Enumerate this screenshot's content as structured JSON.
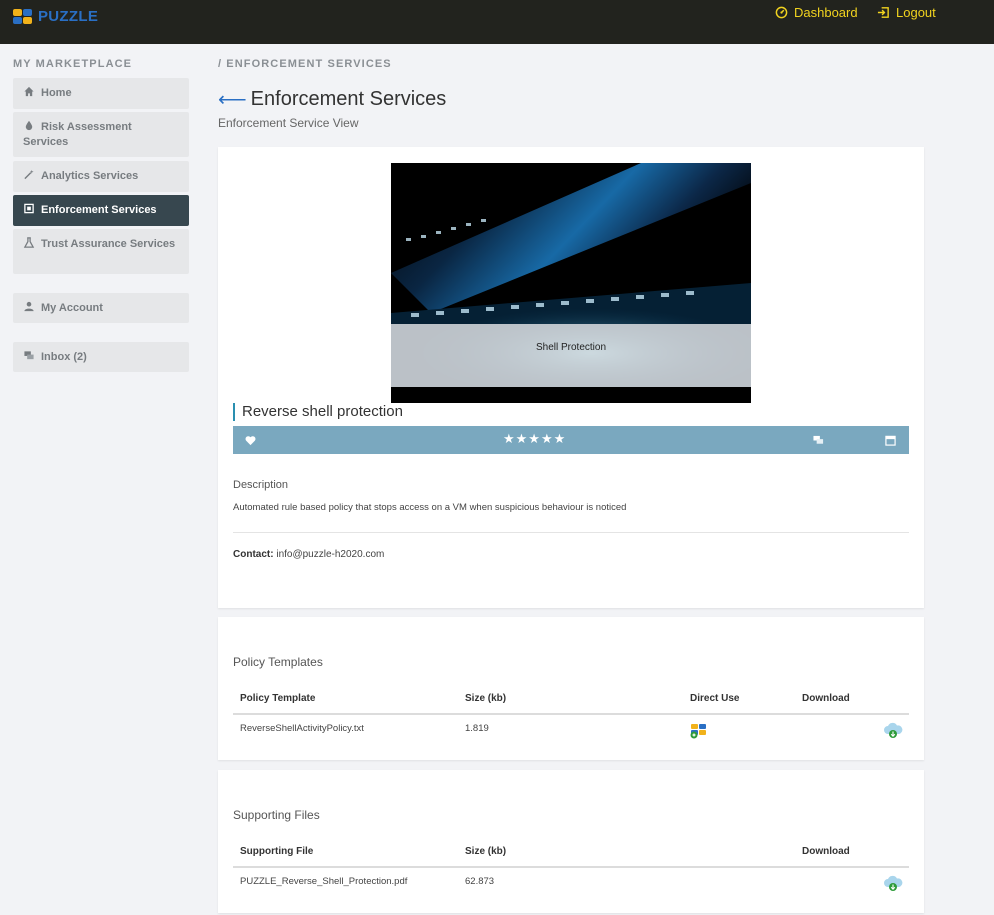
{
  "header": {
    "logo_text": "PUZZLE",
    "nav": [
      {
        "label": "Dashboard",
        "icon": "dashboard-icon"
      },
      {
        "label": "Logout",
        "icon": "logout-icon"
      }
    ]
  },
  "sidebar": {
    "title": "MY MARKETPLACE",
    "items": [
      {
        "label": "Home",
        "icon": "home-icon",
        "active": false
      },
      {
        "label": "Risk Assessment Services",
        "icon": "drop-icon",
        "active": false
      },
      {
        "label": "Analytics Services",
        "icon": "wand-icon",
        "active": false
      },
      {
        "label": "Enforcement Services",
        "icon": "enforcement-icon",
        "active": true
      },
      {
        "label": "Trust Assurance Services",
        "icon": "flask-icon",
        "active": false
      },
      {
        "label": "My Account",
        "icon": "user-icon",
        "active": false
      },
      {
        "label": "Inbox (2)",
        "icon": "chat-icon",
        "active": false
      }
    ]
  },
  "breadcrumb": "/ ENFORCEMENT SERVICES",
  "page": {
    "title": "Enforcement Services",
    "subtitle": "Enforcement Service View"
  },
  "service": {
    "image_caption": "Shell Protection",
    "name": "Reverse shell protection",
    "stars": "★★★★★",
    "rating": 5,
    "description_label": "Description",
    "description": "Automated rule based policy that stops access on a VM when suspicious behaviour is noticed",
    "contact_label": "Contact:",
    "contact_value": "info@puzzle-h2020.com"
  },
  "policy_templates": {
    "title": "Policy Templates",
    "columns": [
      "Policy Template",
      "Size (kb)",
      "Direct Use",
      "Download"
    ],
    "rows": [
      {
        "name": "ReverseShellActivityPolicy.txt",
        "size": "1.819"
      }
    ]
  },
  "supporting_files": {
    "title": "Supporting Files",
    "columns": [
      "Supporting File",
      "Size (kb)",
      "Download"
    ],
    "rows": [
      {
        "name": "PUZZLE_Reverse_Shell_Protection.pdf",
        "size": "62.873"
      }
    ]
  },
  "colors": {
    "topbar": "#22231e",
    "accent_yellow": "#f1d31f",
    "brand_blue": "#2a6fc4",
    "sidebar_active": "#37474f",
    "action_bar": "#7aa8bf"
  }
}
